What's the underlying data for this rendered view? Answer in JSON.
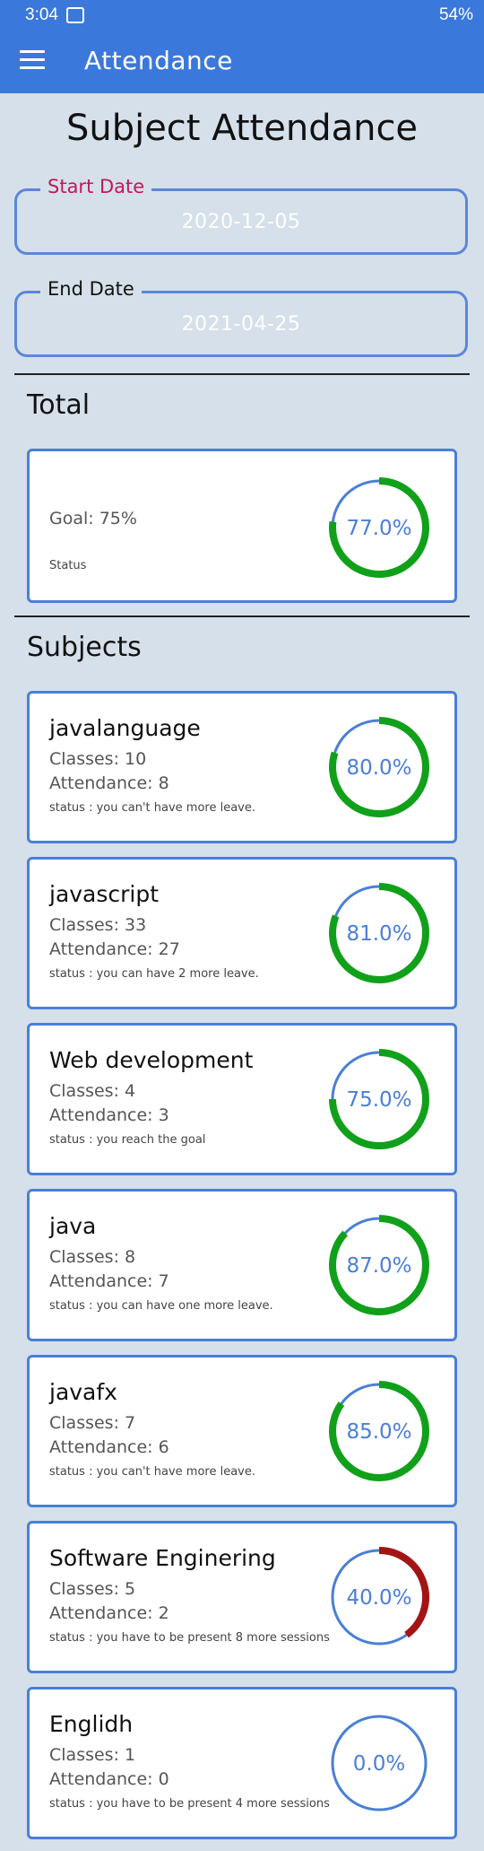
{
  "status_bar": {
    "time": "3:04",
    "right": "54%"
  },
  "appbar": {
    "title": "Attendance"
  },
  "page_title": "Subject Attendance",
  "start_date": {
    "label": "Start Date",
    "value": "2020-12-05",
    "label_color": "#c2185b"
  },
  "end_date": {
    "label": "End Date",
    "value": "2021-04-25"
  },
  "total": {
    "heading": "Total",
    "goal": "Goal: 75%",
    "status": "Status",
    "percent_text": "77.0%",
    "percent": 77.0
  },
  "subjects_heading": "Subjects",
  "subjects": [
    {
      "name": "javalanguage",
      "classes": "Classes: 10",
      "attendance": "Attendance: 8",
      "status": "status : you can't have more leave.",
      "percent_text": "80.0%",
      "percent": 80.0
    },
    {
      "name": "javascript",
      "classes": "Classes: 33",
      "attendance": "Attendance: 27",
      "status": "status : you can have 2 more leave.",
      "percent_text": "81.0%",
      "percent": 81.0
    },
    {
      "name": "Web development",
      "classes": "Classes: 4",
      "attendance": "Attendance: 3",
      "status": "status : you reach the goal",
      "percent_text": "75.0%",
      "percent": 75.0
    },
    {
      "name": "java",
      "classes": "Classes: 8",
      "attendance": "Attendance: 7",
      "status": "status : you can have one more leave.",
      "percent_text": "87.0%",
      "percent": 87.0
    },
    {
      "name": "javafx",
      "classes": "Classes: 7",
      "attendance": "Attendance: 6",
      "status": "status : you can't have more leave.",
      "percent_text": "85.0%",
      "percent": 85.0
    },
    {
      "name": "Software Enginering",
      "classes": "Classes: 5",
      "attendance": "Attendance: 2",
      "status": "status : you have to be present 8 more sessions",
      "percent_text": "40.0%",
      "percent": 40.0
    },
    {
      "name": "Englidh",
      "classes": "Classes: 1",
      "attendance": "Attendance: 0",
      "status": "status : you have to be present 4 more sessions",
      "percent_text": "0.0%",
      "percent": 0.0
    }
  ],
  "colors": {
    "good": "#11a01a",
    "bad": "#a31515",
    "track": "#4a7fd6",
    "accent": "#3a78dc"
  }
}
